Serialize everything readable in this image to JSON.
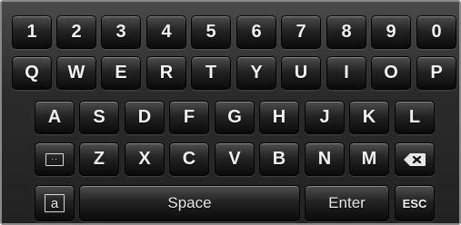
{
  "rows": {
    "numbers": [
      "1",
      "2",
      "3",
      "4",
      "5",
      "6",
      "7",
      "8",
      "9",
      "0"
    ],
    "top": [
      "Q",
      "W",
      "E",
      "R",
      "T",
      "Y",
      "U",
      "I",
      "O",
      "P"
    ],
    "middle": [
      "A",
      "S",
      "D",
      "F",
      "G",
      "H",
      "J",
      "K",
      "L"
    ],
    "bottom": [
      "Z",
      "X",
      "C",
      "V",
      "B",
      "N",
      "M"
    ]
  },
  "special": {
    "caps_icon_text": "··",
    "lowercase_icon_text": "a",
    "space_label": "Space",
    "enter_label": "Enter",
    "esc_label": "ESC"
  },
  "colors": {
    "key_text": "#f2f2f2",
    "key_face": "#1a1a1a",
    "keyboard_bg": "#2b2b2b",
    "border": "#8a8a8a"
  }
}
